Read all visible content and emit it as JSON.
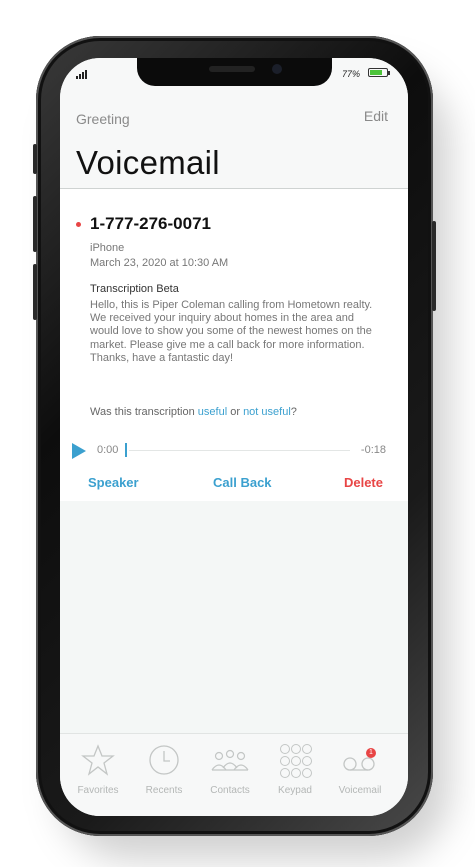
{
  "status": {
    "battery_percent": "77%",
    "battery_level": 0.77
  },
  "header": {
    "greeting": "Greeting",
    "edit": "Edit",
    "title": "Voicemail"
  },
  "voicemail": {
    "number": "1-777-276-0071",
    "device": "iPhone",
    "date": "March 23, 2020 at 10:30 AM",
    "transcription_title": "Transcription Beta",
    "transcription_text": "Hello, this is Piper Coleman calling from Hometown realty. We received your inquiry about homes in the area and would love to show you some of the newest homes on the market. Please give me a call back for more information. Thanks, have a fantastic day!",
    "question_prefix": "Was this transcription ",
    "useful": "useful",
    "or": " or ",
    "not_useful": "not useful",
    "question_suffix": "?",
    "elapsed": "0:00",
    "remaining": "-0:18",
    "speaker": "Speaker",
    "call_back": "Call Back",
    "delete": "Delete"
  },
  "tabs": [
    {
      "label": "Favorites",
      "icon": "star-icon"
    },
    {
      "label": "Recents",
      "icon": "clock-icon"
    },
    {
      "label": "Contacts",
      "icon": "people-icon"
    },
    {
      "label": "Keypad",
      "icon": "keypad-icon"
    },
    {
      "label": "Voicemail",
      "icon": "voicemail-icon",
      "badge": "1"
    }
  ],
  "colors": {
    "accent": "#3ba0cf",
    "danger": "#e84545",
    "battery": "#4cc43a"
  }
}
